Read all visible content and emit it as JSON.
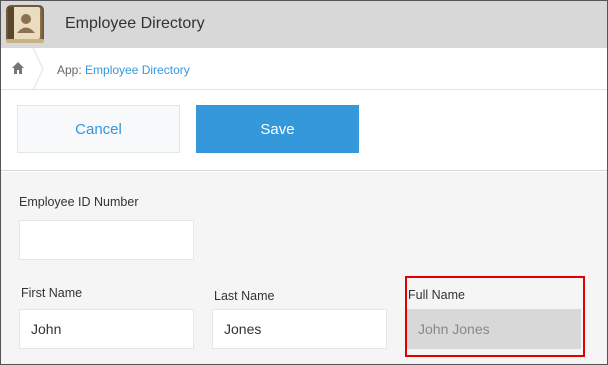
{
  "header": {
    "title": "Employee Directory"
  },
  "breadcrumb": {
    "prefix": "App:",
    "app_link": "Employee Directory"
  },
  "actions": {
    "cancel_label": "Cancel",
    "save_label": "Save"
  },
  "form": {
    "employee_id": {
      "label": "Employee ID Number",
      "value": ""
    },
    "first_name": {
      "label": "First Name",
      "value": "John"
    },
    "last_name": {
      "label": "Last Name",
      "value": "Jones"
    },
    "full_name": {
      "label": "Full Name",
      "value": "John Jones"
    }
  },
  "colors": {
    "accent": "#3498db",
    "header_bg": "#d8d8d8",
    "highlight": "#e00000"
  },
  "icons": {
    "app": "address-book-icon",
    "home": "home-icon",
    "separator": "chevron-right-icon"
  }
}
